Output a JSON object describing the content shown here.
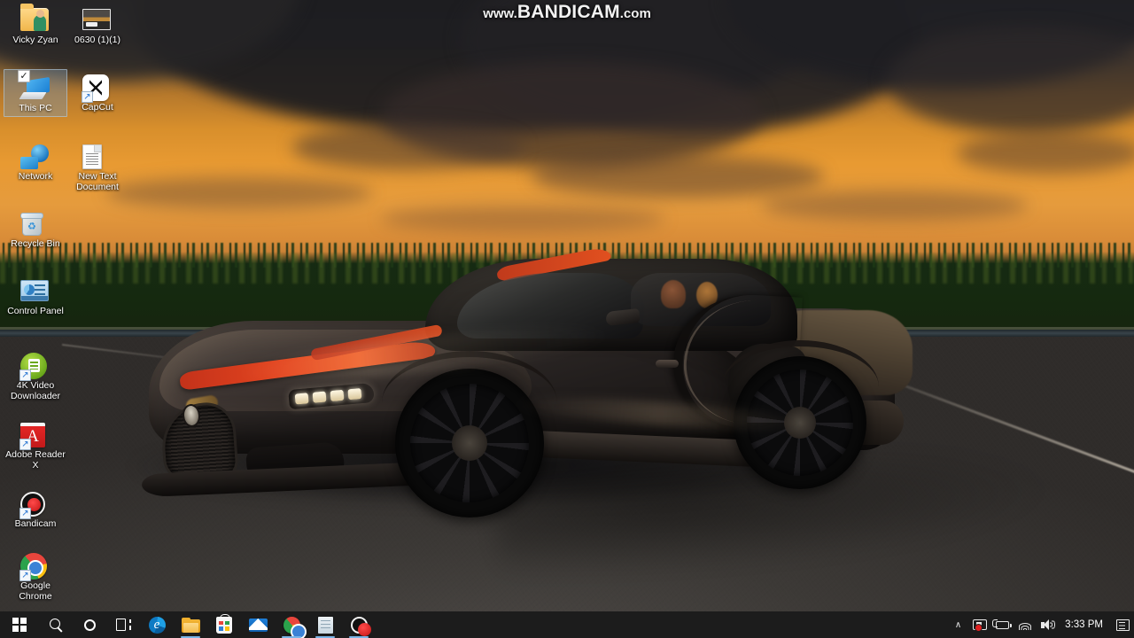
{
  "watermark": {
    "prefix": "www.",
    "brand": "BANDICAM",
    "suffix": ".com"
  },
  "wallpaper": {
    "description": "Bugatti Chiron Super Sport on race track at sunset",
    "sky_color": "#e89a32",
    "cloud_color": "#2a2b2e",
    "forest_color": "#16290f",
    "asphalt_color": "#3c3936",
    "accent_stripe_color": "#e2441f"
  },
  "desktop": {
    "icons": [
      {
        "label": "Vicky Zyan",
        "icon": "folder-user-icon",
        "selected": false,
        "shortcut": false
      },
      {
        "label": "0630 (1)(1)",
        "icon": "image-thumbnail-icon",
        "selected": false,
        "shortcut": false
      },
      {
        "label": "This PC",
        "icon": "this-pc-icon",
        "selected": true,
        "shortcut": false
      },
      {
        "label": "CapCut",
        "icon": "capcut-icon",
        "selected": false,
        "shortcut": true
      },
      {
        "label": "Network",
        "icon": "network-icon",
        "selected": false,
        "shortcut": false
      },
      {
        "label": "New Text Document",
        "icon": "text-document-icon",
        "selected": false,
        "shortcut": false
      },
      {
        "label": "Recycle Bin",
        "icon": "recycle-bin-icon",
        "selected": false,
        "shortcut": false
      },
      {
        "label": "Control Panel",
        "icon": "control-panel-icon",
        "selected": false,
        "shortcut": false
      },
      {
        "label": "4K Video Downloader",
        "icon": "4k-video-downloader-icon",
        "selected": false,
        "shortcut": true
      },
      {
        "label": "Adobe Reader X",
        "icon": "adobe-reader-icon",
        "selected": false,
        "shortcut": true
      },
      {
        "label": "Bandicam",
        "icon": "bandicam-icon",
        "selected": false,
        "shortcut": true
      },
      {
        "label": "Google Chrome",
        "icon": "google-chrome-icon",
        "selected": false,
        "shortcut": true
      }
    ]
  },
  "taskbar": {
    "background": "#1c1c1c",
    "running_indicator_color": "#7ab5e8",
    "buttons": [
      {
        "name": "start-button",
        "tooltip": "Start",
        "icon": "windows-logo-icon",
        "running": false
      },
      {
        "name": "search-button",
        "tooltip": "Search",
        "icon": "search-icon",
        "running": false
      },
      {
        "name": "cortana-button",
        "tooltip": "Cortana",
        "icon": "cortana-circle-icon",
        "running": false
      },
      {
        "name": "task-view-button",
        "tooltip": "Task View",
        "icon": "task-view-icon",
        "running": false
      },
      {
        "name": "microsoft-edge-button",
        "tooltip": "Microsoft Edge",
        "icon": "edge-icon",
        "running": false
      },
      {
        "name": "file-explorer-button",
        "tooltip": "File Explorer",
        "icon": "file-explorer-icon",
        "running": true
      },
      {
        "name": "microsoft-store-button",
        "tooltip": "Microsoft Store",
        "icon": "store-icon",
        "running": false
      },
      {
        "name": "mail-button",
        "tooltip": "Mail",
        "icon": "mail-icon",
        "running": false
      },
      {
        "name": "google-chrome-button",
        "tooltip": "Google Chrome",
        "icon": "chrome-icon",
        "running": true
      },
      {
        "name": "notepad-button",
        "tooltip": "Notepad",
        "icon": "notepad-icon",
        "running": true
      },
      {
        "name": "bandicam-button",
        "tooltip": "Bandicam",
        "icon": "bandicam-record-icon",
        "running": true
      }
    ],
    "tray": {
      "overflow_chevron": "∧",
      "icons": [
        {
          "name": "display-projection-icon",
          "tooltip": "Display / recording"
        },
        {
          "name": "battery-charging-icon",
          "tooltip": "Battery"
        },
        {
          "name": "wifi-icon",
          "tooltip": "Network"
        },
        {
          "name": "volume-icon",
          "tooltip": "Speakers"
        }
      ],
      "clock": {
        "time": "3:33 PM"
      },
      "action_center": {
        "name": "action-center-icon",
        "tooltip": "Notifications"
      }
    }
  }
}
